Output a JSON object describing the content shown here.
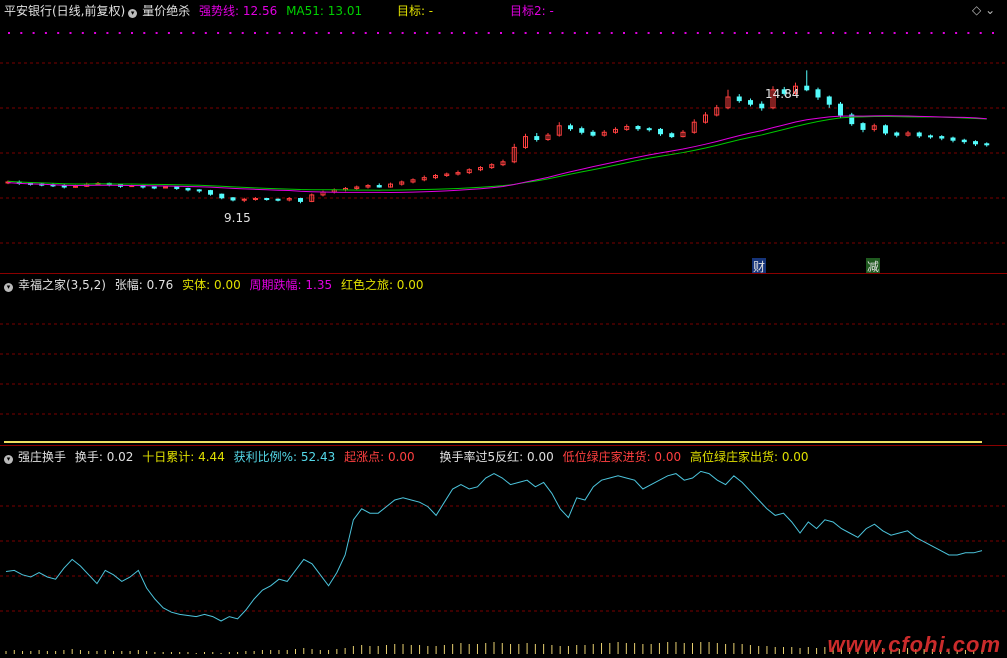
{
  "panel1": {
    "stock": "平安银行(日线,前复权)",
    "indicator": "量价绝杀",
    "strong_label": "强势线: 12.56",
    "ma_label": "MA51: 13.01",
    "target1": "目标: -",
    "target2": "目标2: -",
    "high_label": "14.84",
    "low_label": "9.15",
    "tag_cai": "财",
    "tag_jian": "减",
    "colors": {
      "up": "#ff4040",
      "down": "#54fcfc",
      "ma": "#00c800",
      "strong": "#e000e0"
    }
  },
  "panel2": {
    "name": "幸福之家(3,5,2)",
    "f1": "张幅: 0.76",
    "f2": "实体: 0.00",
    "f3": "周期跌幅: 1.35",
    "f4": "红色之旅: 0.00"
  },
  "panel3": {
    "name": "强庄换手",
    "f1": "换手: 0.02",
    "f2": "十日累计: 4.44",
    "f3": "获利比例%: 52.43",
    "f4": "起涨点: 0.00",
    "f5": "换手率过5反红: 0.00",
    "f6": "低位绿庄家进货: 0.00",
    "f7": "高位绿庄家出货: 0.00"
  },
  "watermark": "www.cfohi.com",
  "candles": [
    [
      9.72,
      9.74,
      9.78,
      9.68
    ],
    [
      9.74,
      9.7,
      9.78,
      9.66
    ],
    [
      9.7,
      9.68,
      9.74,
      9.64
    ],
    [
      9.68,
      9.66,
      9.72,
      9.62
    ],
    [
      9.66,
      9.64,
      9.7,
      9.6
    ],
    [
      9.64,
      9.6,
      9.68,
      9.56
    ],
    [
      9.6,
      9.62,
      9.66,
      9.58
    ],
    [
      9.62,
      9.68,
      9.72,
      9.6
    ],
    [
      9.68,
      9.7,
      9.74,
      9.66
    ],
    [
      9.7,
      9.66,
      9.72,
      9.62
    ],
    [
      9.66,
      9.62,
      9.68,
      9.58
    ],
    [
      9.62,
      9.64,
      9.66,
      9.6
    ],
    [
      9.64,
      9.6,
      9.66,
      9.56
    ],
    [
      9.6,
      9.58,
      9.62,
      9.54
    ],
    [
      9.58,
      9.6,
      9.64,
      9.56
    ],
    [
      9.6,
      9.56,
      9.62,
      9.52
    ],
    [
      9.56,
      9.52,
      9.58,
      9.48
    ],
    [
      9.52,
      9.5,
      9.54,
      9.44
    ],
    [
      9.5,
      9.4,
      9.52,
      9.36
    ],
    [
      9.4,
      9.3,
      9.42,
      9.26
    ],
    [
      9.3,
      9.24,
      9.32,
      9.2
    ],
    [
      9.24,
      9.26,
      9.3,
      9.18
    ],
    [
      9.26,
      9.28,
      9.32,
      9.22
    ],
    [
      9.28,
      9.26,
      9.3,
      9.22
    ],
    [
      9.26,
      9.24,
      9.28,
      9.2
    ],
    [
      9.24,
      9.28,
      9.32,
      9.2
    ],
    [
      9.28,
      9.2,
      9.3,
      9.15
    ],
    [
      9.2,
      9.38,
      9.42,
      9.18
    ],
    [
      9.38,
      9.46,
      9.5,
      9.34
    ],
    [
      9.46,
      9.52,
      9.56,
      9.42
    ],
    [
      9.52,
      9.56,
      9.6,
      9.48
    ],
    [
      9.56,
      9.6,
      9.64,
      9.52
    ],
    [
      9.6,
      9.64,
      9.68,
      9.56
    ],
    [
      9.64,
      9.6,
      9.7,
      9.58
    ],
    [
      9.6,
      9.68,
      9.72,
      9.58
    ],
    [
      9.68,
      9.74,
      9.78,
      9.64
    ],
    [
      9.74,
      9.8,
      9.84,
      9.7
    ],
    [
      9.8,
      9.86,
      9.92,
      9.76
    ],
    [
      9.86,
      9.92,
      9.96,
      9.82
    ],
    [
      9.92,
      9.96,
      10.0,
      9.88
    ],
    [
      9.96,
      10.0,
      10.06,
      9.92
    ],
    [
      10.0,
      10.08,
      10.12,
      9.96
    ],
    [
      10.08,
      10.14,
      10.18,
      10.04
    ],
    [
      10.14,
      10.22,
      10.26,
      10.1
    ],
    [
      10.22,
      10.3,
      10.36,
      10.18
    ],
    [
      10.3,
      10.7,
      10.8,
      10.26
    ],
    [
      10.7,
      11.0,
      11.08,
      10.66
    ],
    [
      11.0,
      10.92,
      11.1,
      10.86
    ],
    [
      10.92,
      11.04,
      11.1,
      10.88
    ],
    [
      11.04,
      11.3,
      11.4,
      11.0
    ],
    [
      11.3,
      11.22,
      11.36,
      11.16
    ],
    [
      11.22,
      11.12,
      11.28,
      11.06
    ],
    [
      11.12,
      11.04,
      11.18,
      11.0
    ],
    [
      11.04,
      11.12,
      11.18,
      11.0
    ],
    [
      11.12,
      11.2,
      11.26,
      11.08
    ],
    [
      11.2,
      11.28,
      11.34,
      11.16
    ],
    [
      11.28,
      11.22,
      11.32,
      11.16
    ],
    [
      11.22,
      11.2,
      11.26,
      11.14
    ],
    [
      11.2,
      11.08,
      11.24,
      11.02
    ],
    [
      11.08,
      11.0,
      11.12,
      10.96
    ],
    [
      11.0,
      11.12,
      11.18,
      10.98
    ],
    [
      11.12,
      11.4,
      11.48,
      11.08
    ],
    [
      11.4,
      11.6,
      11.68,
      11.36
    ],
    [
      11.6,
      11.8,
      11.88,
      11.56
    ],
    [
      11.8,
      12.1,
      12.3,
      11.76
    ],
    [
      12.1,
      12.0,
      12.18,
      11.94
    ],
    [
      12.0,
      11.9,
      12.06,
      11.84
    ],
    [
      11.9,
      11.8,
      11.98,
      11.72
    ],
    [
      11.8,
      12.3,
      12.4,
      11.76
    ],
    [
      12.3,
      12.2,
      12.38,
      12.14
    ],
    [
      12.2,
      12.4,
      12.5,
      12.16
    ],
    [
      12.4,
      12.3,
      12.84,
      12.26
    ],
    [
      12.3,
      12.1,
      12.36,
      12.02
    ],
    [
      12.1,
      11.9,
      12.14,
      11.8
    ],
    [
      11.9,
      11.6,
      11.96,
      11.52
    ],
    [
      11.6,
      11.36,
      11.66,
      11.3
    ],
    [
      11.36,
      11.2,
      11.4,
      11.12
    ],
    [
      11.2,
      11.3,
      11.36,
      11.14
    ],
    [
      11.3,
      11.1,
      11.34,
      11.04
    ],
    [
      11.1,
      11.04,
      11.14,
      10.98
    ],
    [
      11.04,
      11.1,
      11.16,
      11.0
    ],
    [
      11.1,
      11.02,
      11.14,
      10.96
    ],
    [
      11.02,
      11.0,
      11.06,
      10.94
    ],
    [
      11.0,
      10.96,
      11.04,
      10.9
    ],
    [
      10.96,
      10.9,
      11.0,
      10.84
    ],
    [
      10.9,
      10.86,
      10.94,
      10.8
    ],
    [
      10.86,
      10.8,
      10.9,
      10.74
    ],
    [
      10.8,
      10.78,
      10.84,
      10.72
    ]
  ],
  "turnover": [
    0.55,
    0.56,
    0.52,
    0.5,
    0.54,
    0.5,
    0.48,
    0.58,
    0.66,
    0.6,
    0.52,
    0.44,
    0.56,
    0.52,
    0.46,
    0.5,
    0.56,
    0.4,
    0.3,
    0.22,
    0.18,
    0.16,
    0.15,
    0.14,
    0.16,
    0.14,
    0.1,
    0.14,
    0.12,
    0.2,
    0.3,
    0.38,
    0.42,
    0.48,
    0.46,
    0.56,
    0.66,
    0.62,
    0.52,
    0.42,
    0.54,
    0.7,
    1.02,
    1.12,
    1.08,
    1.08,
    1.14,
    1.2,
    1.22,
    1.2,
    1.18,
    1.14,
    1.06,
    1.18,
    1.3,
    1.34,
    1.3,
    1.32,
    1.4,
    1.44,
    1.4,
    1.34,
    1.36,
    1.38,
    1.32,
    1.36,
    1.26,
    1.12,
    1.04,
    1.22,
    1.2,
    1.32,
    1.38,
    1.4,
    1.42,
    1.4,
    1.38,
    1.3,
    1.34,
    1.38,
    1.42,
    1.44,
    1.38,
    1.4,
    1.46,
    1.44,
    1.38,
    1.34,
    1.42,
    1.36,
    1.28,
    1.2,
    1.12,
    1.06,
    1.08,
    1.0,
    0.9,
    1.0,
    0.94,
    1.02,
    1.0,
    0.94,
    0.9,
    0.86,
    0.94,
    0.98,
    0.92,
    0.88,
    0.9,
    0.92,
    0.86,
    0.82,
    0.78,
    0.74,
    0.7,
    0.7,
    0.72,
    0.72,
    0.74
  ],
  "volume": [
    3,
    4,
    3,
    3,
    4,
    3,
    3,
    4,
    5,
    4,
    3,
    3,
    4,
    3,
    3,
    3,
    4,
    3,
    2,
    2,
    2,
    2,
    2,
    1,
    2,
    2,
    1,
    2,
    2,
    3,
    3,
    4,
    4,
    4,
    4,
    5,
    6,
    5,
    4,
    4,
    5,
    6,
    8,
    9,
    8,
    8,
    9,
    10,
    10,
    9,
    9,
    8,
    8,
    9,
    10,
    11,
    10,
    10,
    11,
    12,
    11,
    10,
    10,
    11,
    10,
    10,
    9,
    8,
    8,
    9,
    9,
    10,
    11,
    11,
    12,
    11,
    11,
    10,
    10,
    11,
    12,
    12,
    11,
    11,
    12,
    12,
    11,
    10,
    11,
    10,
    9,
    8,
    8,
    7,
    7,
    7,
    6,
    7,
    6,
    7,
    7,
    6,
    6,
    5,
    6,
    6,
    6,
    5,
    5,
    6,
    5,
    5,
    5,
    4,
    4,
    4,
    4,
    4,
    4
  ]
}
